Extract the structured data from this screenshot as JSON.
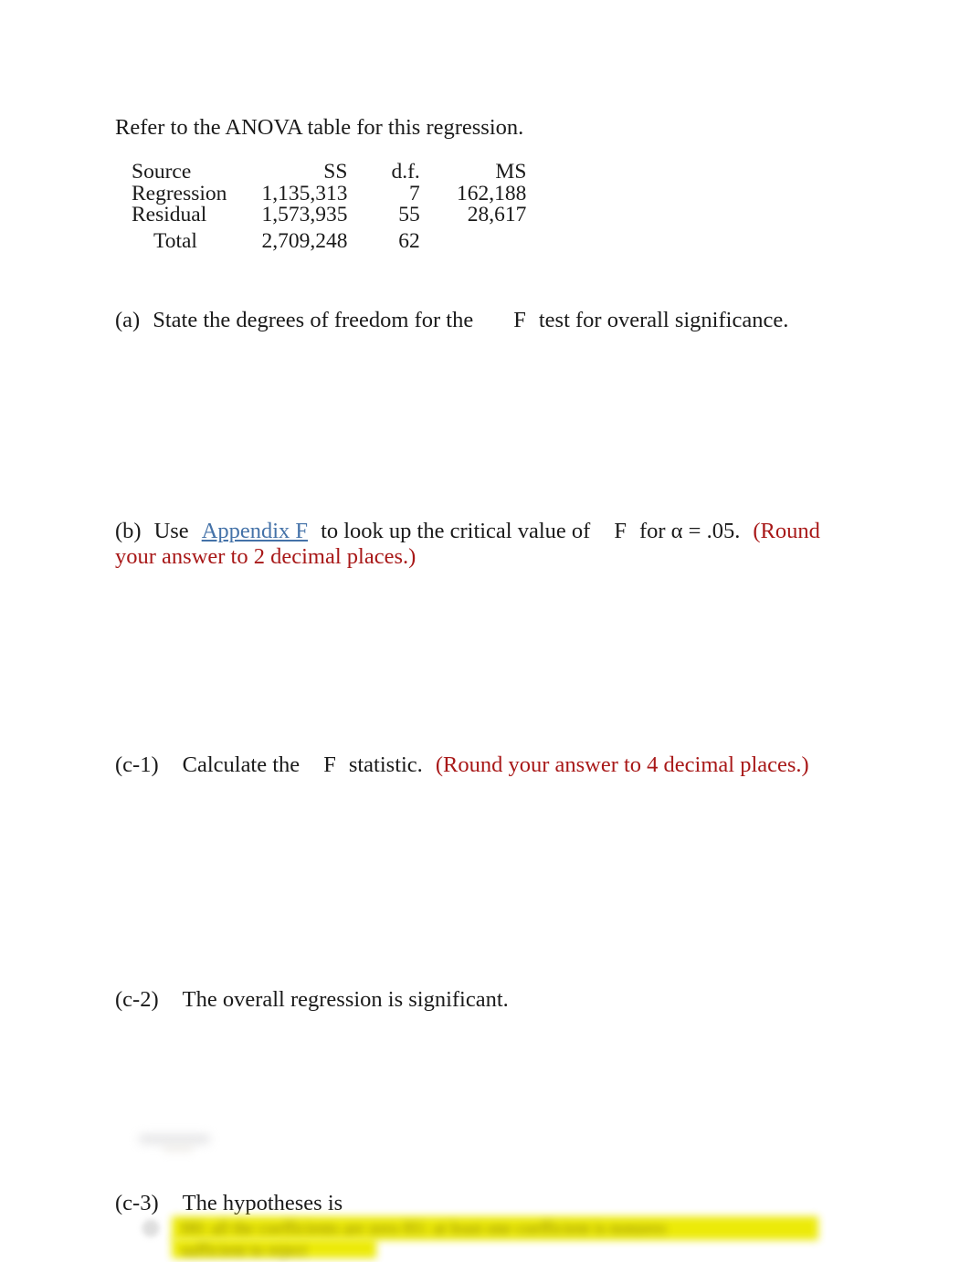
{
  "document": {
    "intro": "Refer to the ANOVA table for this regression.",
    "background_color": "#ffffff",
    "text_color": "#1a1a1a",
    "link_color": "#4472a8",
    "hint_color": "#a81818",
    "highlight_color": "#ecea00"
  },
  "anova_table": {
    "headers": {
      "source": "Source",
      "ss": "SS",
      "df": "d.f.",
      "ms": "MS"
    },
    "rows": [
      {
        "source": "Regression",
        "ss": "1,135,313",
        "df": "7",
        "ms": "162,188"
      },
      {
        "source": "Residual",
        "ss": "1,573,935",
        "df": "55",
        "ms": "28,617"
      },
      {
        "source": "Total",
        "ss": "2,709,248",
        "df": "62",
        "ms": ""
      }
    ]
  },
  "questions": {
    "a": {
      "label": "(a)",
      "text_before": "State the degrees of freedom for the",
      "variable": "F",
      "text_after": "test for overall significance."
    },
    "b": {
      "label": "(b)",
      "text_1": "Use",
      "link": "Appendix F",
      "text_2": "to look up the critical value of",
      "variable": "F",
      "text_3": "for α = .05.",
      "hint": "(Round your answer to 2 decimal places.)"
    },
    "c1": {
      "label": "(c-1)",
      "text_before": "Calculate the",
      "variable": "F",
      "text_after": "statistic.",
      "hint": "(Round your answer to 4 decimal places.)"
    },
    "c2": {
      "label": "(c-2)",
      "text": "The overall regression is significant."
    },
    "c3": {
      "label": "(c-3)",
      "text": "The hypotheses is"
    }
  },
  "answer_option": {
    "state": "redacted-blurred-highlighted",
    "line_1": "H0: all the coefficients are zero    H1: at least one coefficient is nonzero",
    "line_2": "sufficient to reject"
  }
}
